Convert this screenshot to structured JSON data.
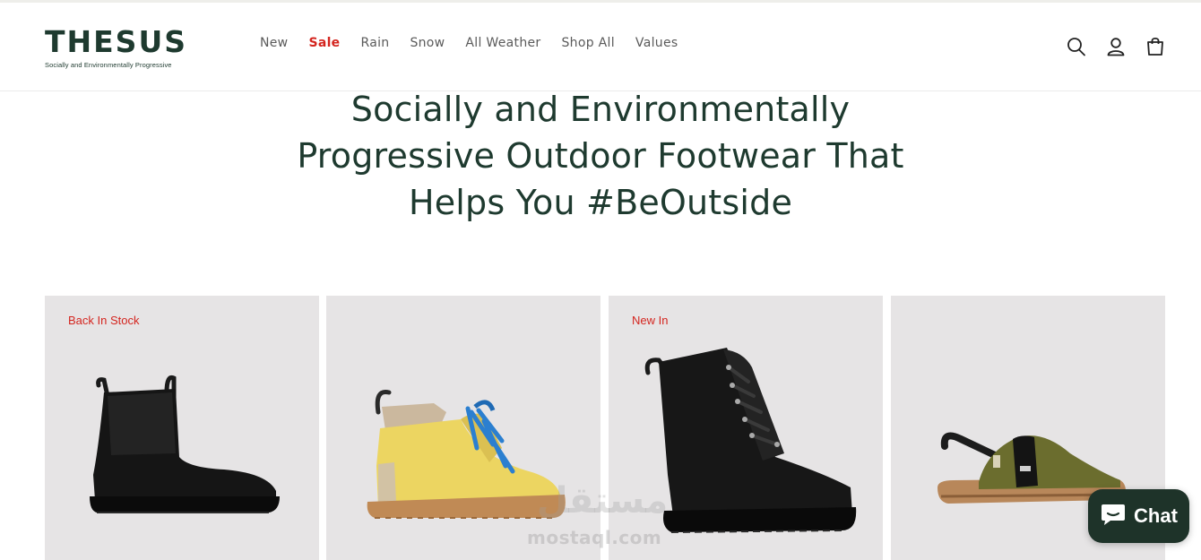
{
  "brand": {
    "name": "THESUS",
    "tagline": "Socially and Environmentally Progressive"
  },
  "nav": {
    "items": [
      {
        "label": "New"
      },
      {
        "label": "Sale"
      },
      {
        "label": "Rain"
      },
      {
        "label": "Snow"
      },
      {
        "label": "All Weather"
      },
      {
        "label": "Shop All"
      },
      {
        "label": "Values"
      }
    ]
  },
  "header_icons": [
    "search-icon",
    "account-icon",
    "cart-icon"
  ],
  "hero": {
    "line1": "Socially and Environmentally",
    "line2": "Progressive Outdoor Footwear That",
    "line3": "Helps You #BeOutside"
  },
  "products": [
    {
      "badge": "Back In Stock",
      "image": "black-chelsea-boot"
    },
    {
      "badge": "",
      "image": "yellow-hiking-boot"
    },
    {
      "badge": "New In",
      "image": "black-lace-up-boot"
    },
    {
      "badge": "",
      "image": "olive-slingback-clog"
    }
  ],
  "watermark": {
    "text": "mostaql.com",
    "arabic": "مستقل"
  },
  "chat": {
    "label": "Chat"
  },
  "colors": {
    "brand_green": "#1e3a2f",
    "sale_red": "#d4251f",
    "card_bg": "#e6e4e5",
    "chat_bg": "#1e3329"
  }
}
